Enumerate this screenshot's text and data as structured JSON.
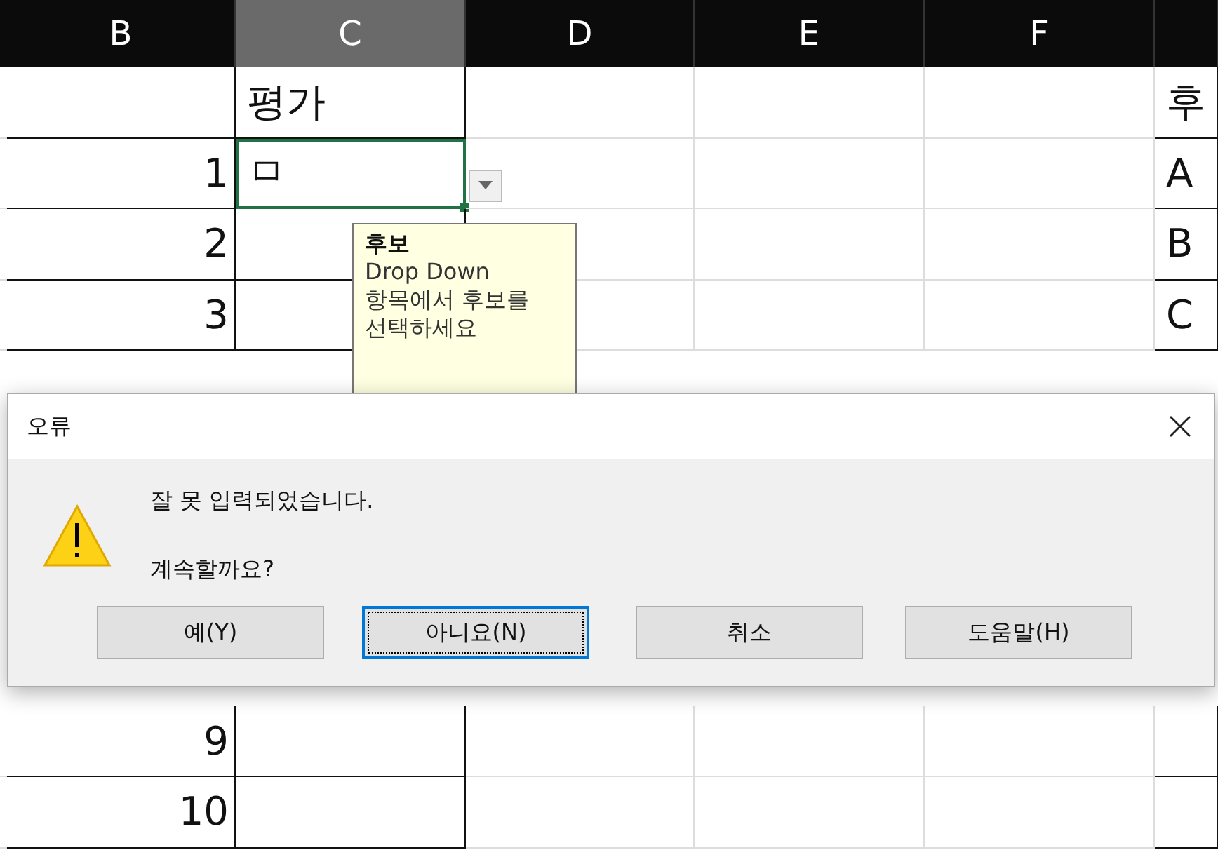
{
  "columns": [
    {
      "label": "B",
      "selected": false
    },
    {
      "label": "C",
      "selected": true
    },
    {
      "label": "D",
      "selected": false
    },
    {
      "label": "E",
      "selected": false
    },
    {
      "label": "F",
      "selected": false
    },
    {
      "selected": false
    }
  ],
  "rows": [
    {
      "column_c": "평가",
      "column_g": "후",
      "selected": false
    },
    {
      "column_b": "1",
      "column_c": "ㅁ",
      "column_g": "A",
      "selected": true
    },
    {
      "column_b": "2",
      "column_g": "B",
      "selected": false
    },
    {
      "column_b": "3",
      "column_g": "C",
      "selected": false
    },
    {
      "column_b": "9",
      "selected": false
    },
    {
      "column_b": "10",
      "selected": false
    }
  ],
  "tooltip": {
    "title": "후보",
    "lines": [
      "Drop Down",
      "항목에서 후보를",
      "선택하세요"
    ]
  },
  "dialog": {
    "title": "오류",
    "message": "잘 못 입력되었습니다.",
    "question": "계속할까요?",
    "buttons": [
      {
        "label": "예(Y)",
        "focused": false
      },
      {
        "label": "아니요(N)",
        "focused": true
      },
      {
        "label": "취소",
        "focused": false
      },
      {
        "label": "도움말(H)",
        "focused": false
      }
    ]
  }
}
